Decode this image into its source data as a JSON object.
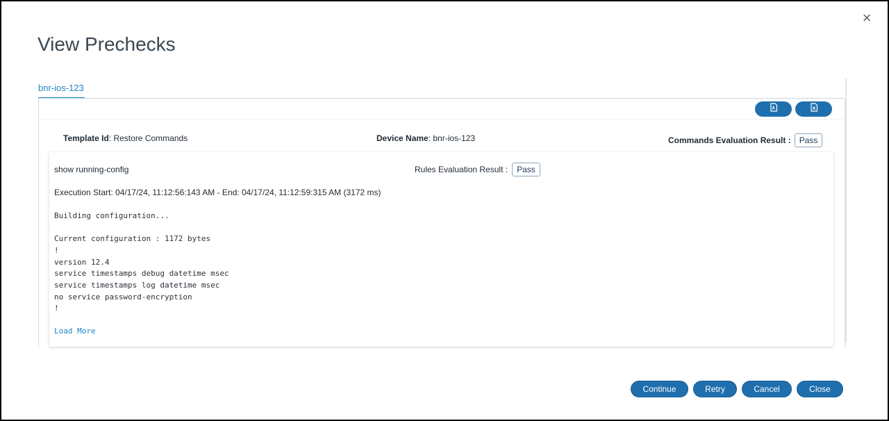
{
  "dialog": {
    "title": "View Prechecks",
    "close_glyph": "×"
  },
  "tabs": [
    {
      "label": "bnr-ios-123",
      "active": true
    }
  ],
  "toolbar": {
    "export_pdf_icon": "pdf-export-icon",
    "export_excel_icon": "excel-export-icon"
  },
  "summary": {
    "template_id_label": "Template Id",
    "template_id_value": ": Restore Commands",
    "device_name_label": "Device Name",
    "device_name_value": ": bnr-ios-123",
    "commands_result_label": "Commands Evaluation Result :",
    "commands_result_value": "Pass"
  },
  "command_card": {
    "command": "show running-config",
    "rules_result_label": "Rules Evaluation Result :",
    "rules_result_value": "Pass",
    "execution": "Execution Start: 04/17/24, 11:12:56:143 AM - End: 04/17/24, 11:12:59:315 AM (3172 ms)",
    "output_lines": [
      "Building configuration...",
      "",
      "Current configuration : 1172 bytes",
      "!",
      "version 12.4",
      "service timestamps debug datetime msec",
      "service timestamps log datetime msec",
      "no service password-encryption",
      "!"
    ],
    "load_more": "Load More"
  },
  "footer": {
    "continue": "Continue",
    "retry": "Retry",
    "cancel": "Cancel",
    "close": "Close"
  },
  "colors": {
    "accent": "#1d87c7",
    "button": "#1f6fae"
  }
}
